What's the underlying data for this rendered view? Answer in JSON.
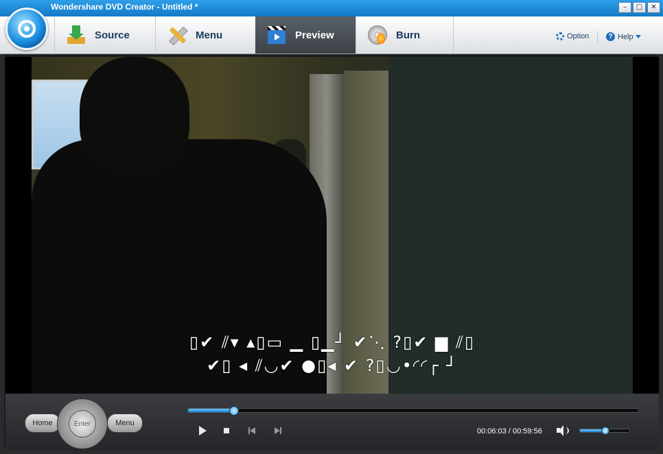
{
  "window": {
    "title": "Wondershare DVD Creator - Untitled *",
    "controls": {
      "minimize": "–",
      "maximize": "□",
      "close": "✕"
    }
  },
  "tabs": [
    {
      "label": "Source",
      "icon": "source-download-icon",
      "active": false
    },
    {
      "label": "Menu",
      "icon": "menu-tools-icon",
      "active": false
    },
    {
      "label": "Preview",
      "icon": "preview-clapper-icon",
      "active": true
    },
    {
      "label": "Burn",
      "icon": "burn-disc-icon",
      "active": false
    }
  ],
  "header_links": {
    "option": "Option",
    "help": "Help"
  },
  "subtitles": {
    "line1": "▯✔ ⫽▾ ▴▯▭ ▁ ▯▁┘ ✔⋱ ?▯✔ ▆ ⫽▯",
    "line2": "✔▯ ◂ ⫽◡✔ ●▯◂ ✔ ?▯◡•◜◜┌ ┘"
  },
  "dvd_remote": {
    "home": "Home",
    "enter": "Enter",
    "menu": "Menu"
  },
  "playback": {
    "current_time": "00:06:03",
    "separator": "/",
    "total_time": "00:59:56",
    "progress_fraction": 0.101,
    "volume_fraction": 0.5
  },
  "colors": {
    "accent": "#1f86d8",
    "titlebar": "#1a86d8",
    "active_tab": "#4a4f56"
  }
}
